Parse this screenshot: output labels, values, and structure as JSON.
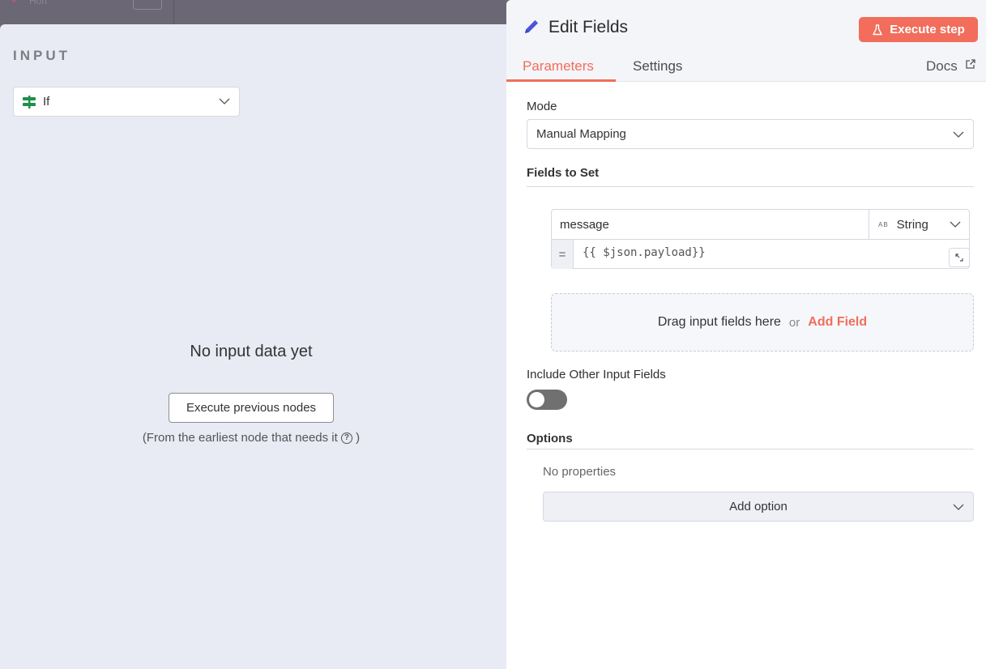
{
  "canvas": {
    "breadcrumb": "Hori"
  },
  "input_panel": {
    "title": "INPUT",
    "node_select": {
      "value": "If",
      "icon": "if-node-icon"
    },
    "empty_message": "No input data yet",
    "execute_button": "Execute previous nodes",
    "hint_before": "(From the earliest node that needs it",
    "hint_after": ")"
  },
  "edit_panel": {
    "title": "Edit Fields",
    "execute_button": "Execute step",
    "tabs": [
      {
        "label": "Parameters",
        "active": true
      },
      {
        "label": "Settings",
        "active": false
      }
    ],
    "docs_label": "Docs",
    "mode": {
      "label": "Mode",
      "value": "Manual Mapping"
    },
    "fields_to_set": {
      "label": "Fields to Set",
      "fields": [
        {
          "name": "message",
          "type": "String",
          "type_badge": "AB",
          "operator": "=",
          "value": "{{ $json.payload}}"
        }
      ],
      "drop_zone": {
        "text": "Drag input fields here",
        "or": "or",
        "add_label": "Add Field"
      }
    },
    "include_other": {
      "label": "Include Other Input Fields",
      "enabled": false
    },
    "options": {
      "label": "Options",
      "empty_text": "No properties",
      "add_label": "Add option"
    }
  },
  "colors": {
    "accent": "#f26d5b",
    "panel_bg": "#e8eaf4",
    "pencil": "#4a55d8"
  }
}
